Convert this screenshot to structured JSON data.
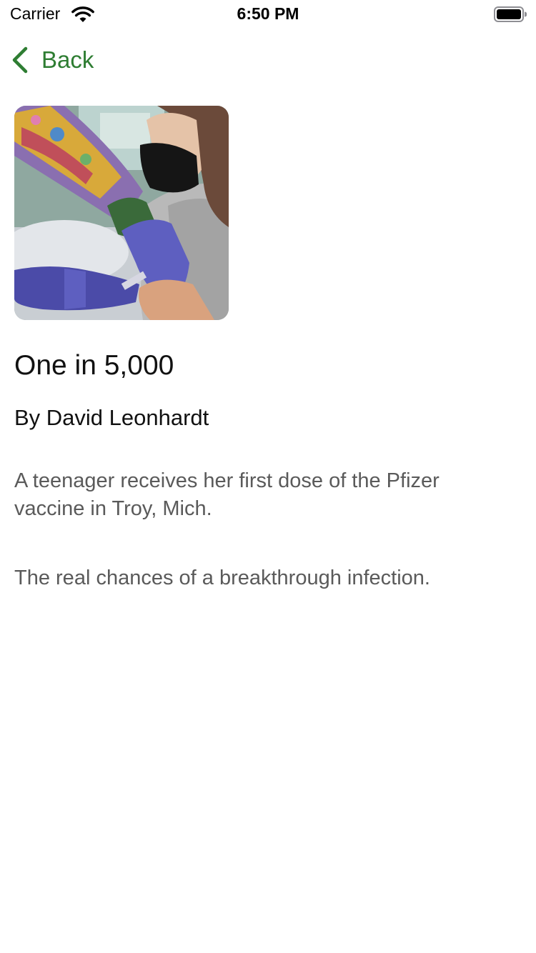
{
  "status_bar": {
    "carrier": "Carrier",
    "time": "6:50 PM"
  },
  "nav": {
    "back_label": "Back",
    "accent_color": "#2e7d32"
  },
  "article": {
    "image_icon": "photo-vaccination",
    "title": "One in 5,000",
    "byline": "By David Leonhardt",
    "caption": "A teenager receives her first dose of the Pfizer vaccine in Troy, Mich.",
    "summary": "The real chances of a breakthrough infection."
  }
}
